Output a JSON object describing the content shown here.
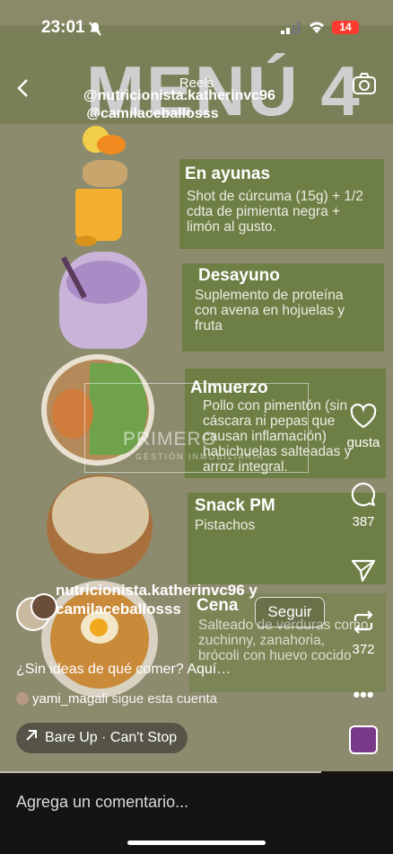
{
  "status": {
    "time": "23:01",
    "battery": "14"
  },
  "header": {
    "title": "Reels",
    "author1": "@nutricionista.katherinvc96",
    "author2": "@camilaceballosss"
  },
  "post": {
    "banner": "MENÚ 4",
    "meals": [
      {
        "title": "En ayunas",
        "text": "Shot de cúrcuma (15g) + 1/2 cdta de pimienta negra + limón al gusto."
      },
      {
        "title": "Desayuno",
        "text": "Suplemento de proteína con avena en hojuelas y fruta"
      },
      {
        "title": "Almuerzo",
        "text": "Pollo con pimentón (sin cáscara ni pepas que causan inflamación) habichuelas salteadas y arroz integral."
      },
      {
        "title": "Snack PM",
        "text": "Pistachos"
      },
      {
        "title": "Cena",
        "text": "Salteado de verduras como zuchinny, zanahoria, brócoli con huevo cocido"
      }
    ],
    "watermark": {
      "brand": "PRIMERO",
      "sub": "GESTIÓN INMOBILIARIA"
    }
  },
  "actions": {
    "likes": "gusta",
    "comments": "387",
    "reposts": "372"
  },
  "reel": {
    "username": "nutricionista.katherinvc96 y camilaceballosss",
    "follow": "Seguir",
    "caption": "¿Sin ideas de qué comer? Aquí…",
    "follower_name": "yami_magali",
    "follower_text": "sigue esta cuenta",
    "music": "Bare Up · Can't Stop"
  },
  "comment_placeholder": "Agrega un comentario..."
}
